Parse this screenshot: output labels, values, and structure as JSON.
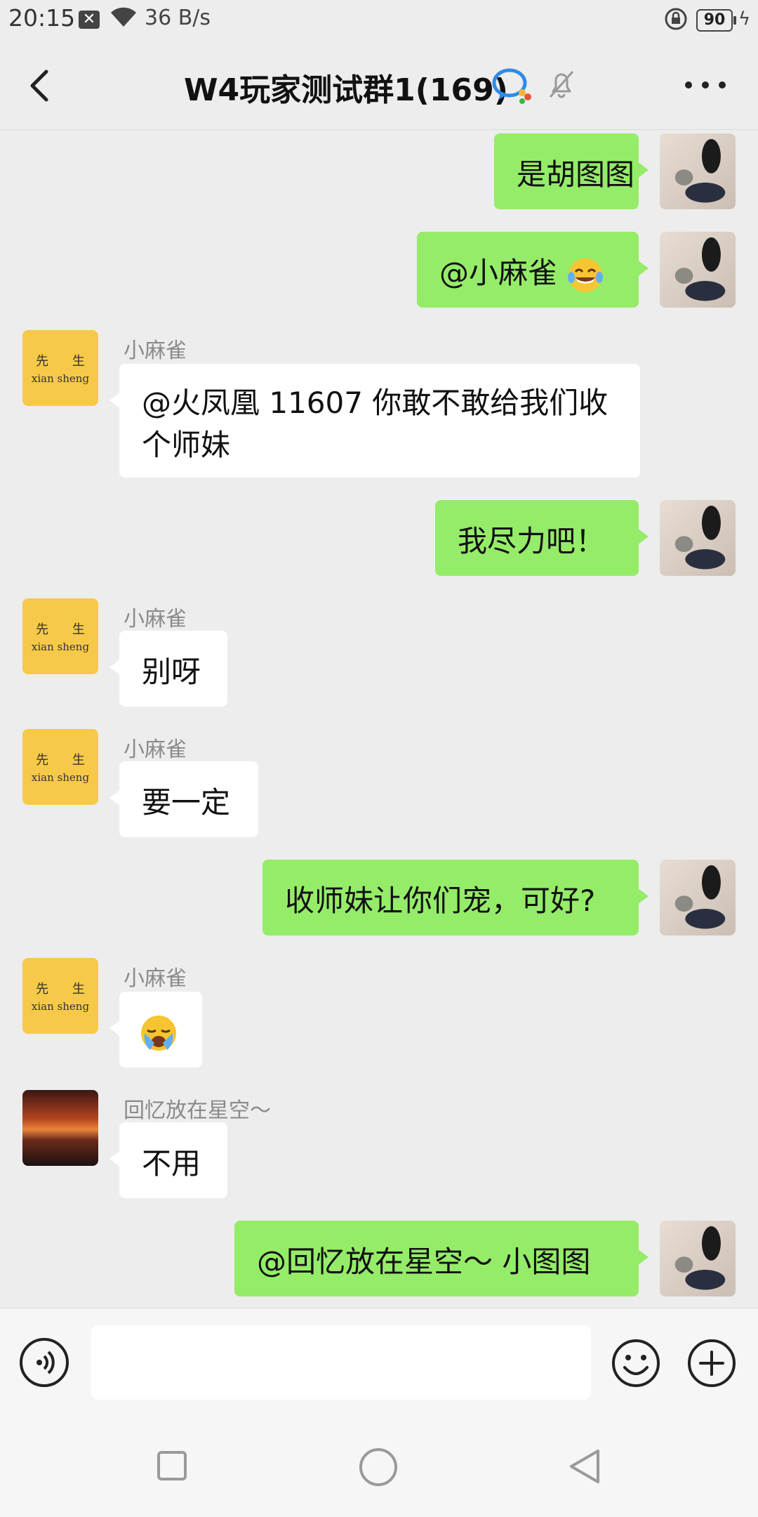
{
  "status_bar": {
    "time": "20:15",
    "net_speed": "36 B/s",
    "battery": "90",
    "notif_icon": "x-box-icon"
  },
  "header": {
    "title": "W4玩家测试群1(169)"
  },
  "messages": [
    {
      "side": "right",
      "text": "是胡图图"
    },
    {
      "side": "right",
      "text": "@小麻雀 ",
      "emoji": "tears-of-joy"
    },
    {
      "side": "left",
      "sender": "小麻雀",
      "text": "@火凤凰 11607  你敢不敢给我们收个师妹"
    },
    {
      "side": "right",
      "text": "我尽力吧！"
    },
    {
      "side": "left",
      "sender": "小麻雀",
      "text": "别呀"
    },
    {
      "side": "left",
      "sender": "小麻雀",
      "text": "要一定"
    },
    {
      "side": "right",
      "text": "收师妹让你们宠，可好?"
    },
    {
      "side": "left",
      "sender": "小麻雀",
      "text": "",
      "emoji": "loudly-crying"
    },
    {
      "side": "left",
      "sender": "回忆放在星空～",
      "text": "不用"
    },
    {
      "side": "right",
      "text": "@回忆放在星空～  小图图"
    }
  ],
  "avatars": {
    "self": "photo-avatar",
    "xiaomaque": {
      "line1": "先 生",
      "line2": "xian  sheng"
    },
    "huiyi": "sunset-photo-avatar"
  },
  "input_bar": {
    "placeholder": ""
  },
  "colors": {
    "bubble_me": "#95ec69",
    "bubble_other": "#ffffff",
    "background": "#ededed"
  }
}
